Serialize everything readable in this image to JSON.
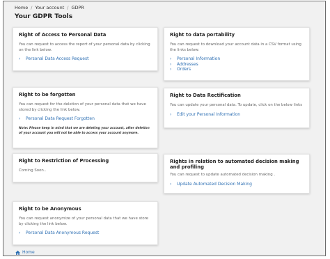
{
  "breadcrumb": {
    "items": [
      "Home",
      "Your account",
      "GDPR"
    ]
  },
  "page_title": "Your GDPR Tools",
  "cards": {
    "access": {
      "title": "Right of Access to Personal Data",
      "desc": "You can request to access the report of your personal data by clicking on the link below.",
      "link": "Personal Data Access Request"
    },
    "portability": {
      "title": "Right to data portability",
      "desc": "You can request to download your account data in a CSV format using the links below:",
      "links": [
        "Personal Information",
        "Addresses",
        "Orders"
      ]
    },
    "forgotten": {
      "title": "Right to be forgotten",
      "desc": "You can request for the deletion of your personal data that we have stored by clicking the link below.",
      "link": "Personal Data Request Forgotten",
      "note": "Note: Please keep in mind that we are deleting your account, after deletion of your account you will not be able to access your account anymore."
    },
    "rectification": {
      "title": "Right to Data Rectification",
      "desc": "You can update your personal data. To update, click on the below links",
      "link": "Edit your Personal Information"
    },
    "restriction": {
      "title": "Right to Restriction of Processing",
      "text": "Coming Soon.."
    },
    "automated": {
      "title": "Rights in relation to automated decision making and profiling",
      "desc": "You can request to update automated decision making .",
      "link": "Update Automated Decision Making"
    },
    "anonymous": {
      "title": "Right to be Anonymous",
      "desc": "You can request anonymize of your personal data that we have store by clicking the link below.",
      "link": "Personal Data Anonymous Request"
    }
  },
  "footer": {
    "home_label": "Home"
  },
  "colors": {
    "link": "#2d6fb3",
    "background": "#f1f1f1",
    "card": "#ffffff"
  },
  "icons": {
    "link_bullet": "chevron-right-icon",
    "home": "home-icon"
  }
}
